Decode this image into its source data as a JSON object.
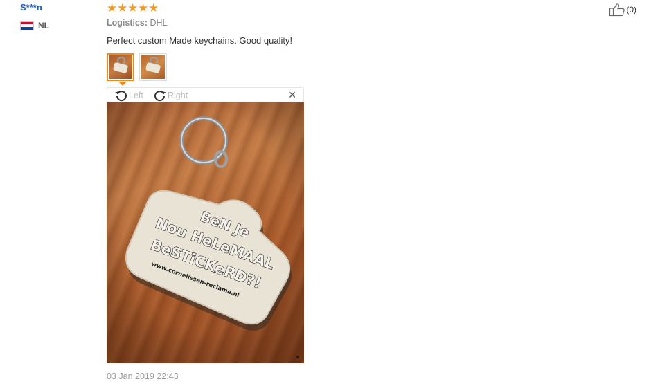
{
  "reviewer": {
    "name": "S***n",
    "country": "NL"
  },
  "rating": {
    "stars": 5,
    "max": 5,
    "star_color": "#f79a1c"
  },
  "logistics": {
    "label": "Logistics:",
    "value": "DHL"
  },
  "review": {
    "text": "Perfect custom Made keychains. Good quality!"
  },
  "thumbnails": [
    {
      "name": "photo-1",
      "selected": true
    },
    {
      "name": "photo-2",
      "selected": false
    }
  ],
  "viewer": {
    "rotate_left_label": "Left",
    "rotate_right_label": "Right",
    "close_icon": "close-icon",
    "image_text": {
      "line1": "BeN Je",
      "line2": "Nou HeLeMAAL",
      "line3": "BeSTiCKeRD?!",
      "url": "www.cornelissen-reclame.nl"
    }
  },
  "date": "03 Jan 2019 22:43",
  "helpful": {
    "count_label": "(0)",
    "icon": "thumbs-up-icon"
  },
  "colors": {
    "link": "#1d5ebf",
    "accent": "#f08a1e",
    "muted": "#9a9a9a"
  }
}
